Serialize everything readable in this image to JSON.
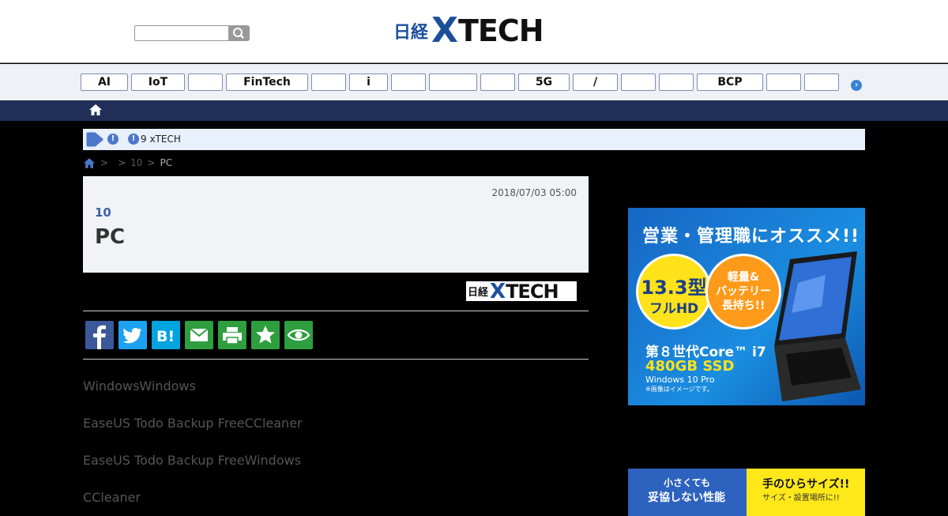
{
  "header": {
    "search": {
      "value": "",
      "placeholder": "",
      "button_icon": "search-icon"
    },
    "logo": {
      "prefix": "日経",
      "x": "X",
      "tech": "TECH"
    }
  },
  "nav": {
    "tags": [
      {
        "label": "AI"
      },
      {
        "label": "IoT"
      },
      {
        "label": ""
      },
      {
        "label": "FinTech"
      },
      {
        "label": ""
      },
      {
        "label": "i"
      },
      {
        "label": ""
      },
      {
        "label": ""
      },
      {
        "label": ""
      },
      {
        "label": "5G"
      },
      {
        "label": "/"
      },
      {
        "label": ""
      },
      {
        "label": ""
      },
      {
        "label": "BCP"
      },
      {
        "label": ""
      },
      {
        "label": ""
      }
    ],
    "next_icon": "chevron-right-icon",
    "next_glyph": "›"
  },
  "homebar": {
    "icon": "home-icon"
  },
  "notice": {
    "text": "9 xTECH",
    "badge": "!"
  },
  "breadcrumb": {
    "sep1": ">",
    "sep2": ">",
    "item2": "10",
    "sep3": ">",
    "current": "PC"
  },
  "article": {
    "date": "2018/07/03 05:00",
    "series": "10",
    "title": "PC",
    "source_logo": {
      "prefix": "日経",
      "x": "X",
      "tech": "TECH"
    },
    "share_buttons": [
      {
        "name": "facebook",
        "color": "#3b5998"
      },
      {
        "name": "twitter",
        "color": "#1da1f2"
      },
      {
        "name": "hatena",
        "color": "#00a4de"
      },
      {
        "name": "mail",
        "color": "#2e9e3f"
      },
      {
        "name": "print",
        "color": "#2e9e3f"
      },
      {
        "name": "favorite",
        "color": "#2e9e3f"
      },
      {
        "name": "watch",
        "color": "#2e9e3f"
      }
    ],
    "paragraphs": [
      "WindowsWindows",
      "EaseUS Todo Backup FreeCCleaner",
      "EaseUS Todo Backup FreeWindows",
      "CCleaner"
    ]
  },
  "ad1": {
    "headline": "営業・管理職にオススメ!!",
    "badge1_a": "13.3型",
    "badge1_b": "フルHD",
    "badge2": "軽量&\nバッテリー\n長持ち!!",
    "spec1": "第８世代Core™ i7",
    "spec2": "480GB SSD",
    "spec3": "Windows 10 Pro",
    "spec4": "※画像はイメージです。"
  },
  "ad2": {
    "left_1": "小さくても",
    "left_2": "妥協しない性能",
    "right_1": "手のひらサイズ!!",
    "right_2": "サイズ・設置場所に!!"
  }
}
